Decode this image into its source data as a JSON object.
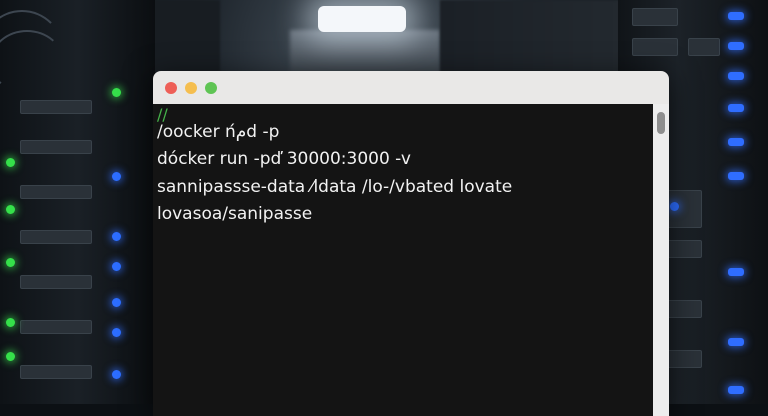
{
  "terminal": {
    "lines": [
      {
        "text": "//",
        "kind": "comment"
      },
      {
        "text": "/oocker nم́d -p",
        "kind": "command"
      },
      {
        "text": "dócker run -pď 30000:3000 -v",
        "kind": "command"
      },
      {
        "text": "sannipassse-data ⁄ldata /lo-/vbated lovate",
        "kind": "command"
      },
      {
        "text": "lovasoa/sanipasse",
        "kind": "command"
      }
    ],
    "window_buttons": [
      "close",
      "minimize",
      "zoom"
    ]
  },
  "colors": {
    "terminal_bg": "#141414",
    "titlebar_bg": "#e9e8e7",
    "comment_green": "#45b34a",
    "text": "#f2f2f2",
    "close": "#ee5f57",
    "minimize": "#f5be4f",
    "zoom": "#5fc454",
    "led_green": "#35e04a",
    "led_blue": "#2c6dff"
  }
}
